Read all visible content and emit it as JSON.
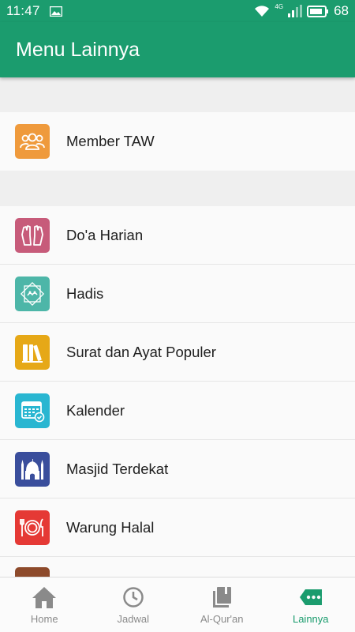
{
  "status_bar": {
    "time": "11:47",
    "network": "4G",
    "battery": "68",
    "icons": [
      "image-icon",
      "wifi-icon",
      "signal-icon",
      "battery-icon"
    ]
  },
  "app_bar": {
    "title": "Menu Lainnya"
  },
  "menu_groups": [
    {
      "items": [
        {
          "label": "Member TAW",
          "icon": "group-people-icon",
          "color": "#ef9a3c"
        }
      ]
    },
    {
      "items": [
        {
          "label": "Do'a Harian",
          "icon": "praying-hands-icon",
          "color": "#c75b7a"
        },
        {
          "label": "Hadis",
          "icon": "hadith-calligraphy-icon",
          "color": "#4db6a8"
        },
        {
          "label": "Surat dan Ayat Populer",
          "icon": "books-icon",
          "color": "#e6a817"
        },
        {
          "label": "Kalender",
          "icon": "calendar-icon",
          "color": "#29b6d1"
        },
        {
          "label": "Masjid Terdekat",
          "icon": "mosque-icon",
          "color": "#3a4e9c"
        },
        {
          "label": "Warung Halal",
          "icon": "plate-cutlery-icon",
          "color": "#e53935"
        }
      ]
    }
  ],
  "partial_item": {
    "icon": "brown-item-icon",
    "color": "#8d4a2b"
  },
  "bottom_nav": {
    "items": [
      {
        "label": "Home",
        "icon": "home-icon",
        "active": false
      },
      {
        "label": "Jadwal",
        "icon": "clock-icon",
        "active": false
      },
      {
        "label": "Al-Qur'an",
        "icon": "quran-book-icon",
        "active": false
      },
      {
        "label": "Lainnya",
        "icon": "more-tag-icon",
        "active": true
      }
    ],
    "active_color": "#1b9c6e",
    "inactive_color": "#8a8a8a"
  },
  "colors": {
    "primary": "#1b9c6e"
  }
}
